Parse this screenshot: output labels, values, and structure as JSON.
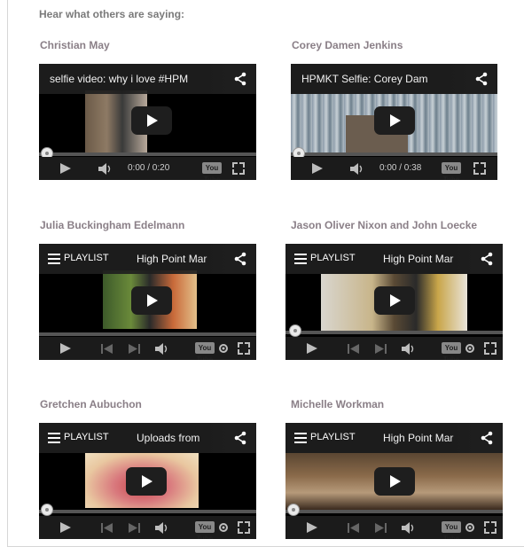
{
  "heading": "Hear what others are saying:",
  "videos": [
    {
      "person": "Christian May",
      "type": "video",
      "title": "selfie video: why i love #HPM",
      "time": "0:00 / 0:20",
      "youtube": "You Tube"
    },
    {
      "person": "Corey Damen Jenkins",
      "type": "video",
      "title": "HPMKT Selfie: Corey Dam",
      "time": "0:00 / 0:38",
      "youtube": "You Tube"
    },
    {
      "person": "Julia Buckingham Edelmann",
      "type": "playlist",
      "playlist_label": "PLAYLIST",
      "title": "High Point Mar",
      "youtube": "You Tube"
    },
    {
      "person": "Jason Oliver Nixon and John Loecke",
      "type": "playlist",
      "playlist_label": "PLAYLIST",
      "title": "High Point Mar",
      "youtube": "You Tube"
    },
    {
      "person": "Gretchen Aubuchon",
      "type": "playlist",
      "playlist_label": "PLAYLIST",
      "title": "Uploads from",
      "youtube": "You Tube"
    },
    {
      "person": "Michelle Workman",
      "type": "playlist",
      "playlist_label": "PLAYLIST",
      "title": "High Point Mar",
      "youtube": "You Tube"
    }
  ],
  "colors": {
    "heading": "#7a7a7a",
    "name": "#8a7f87",
    "player_bg": "#000000",
    "controls_bg": "#1b1b1b"
  }
}
